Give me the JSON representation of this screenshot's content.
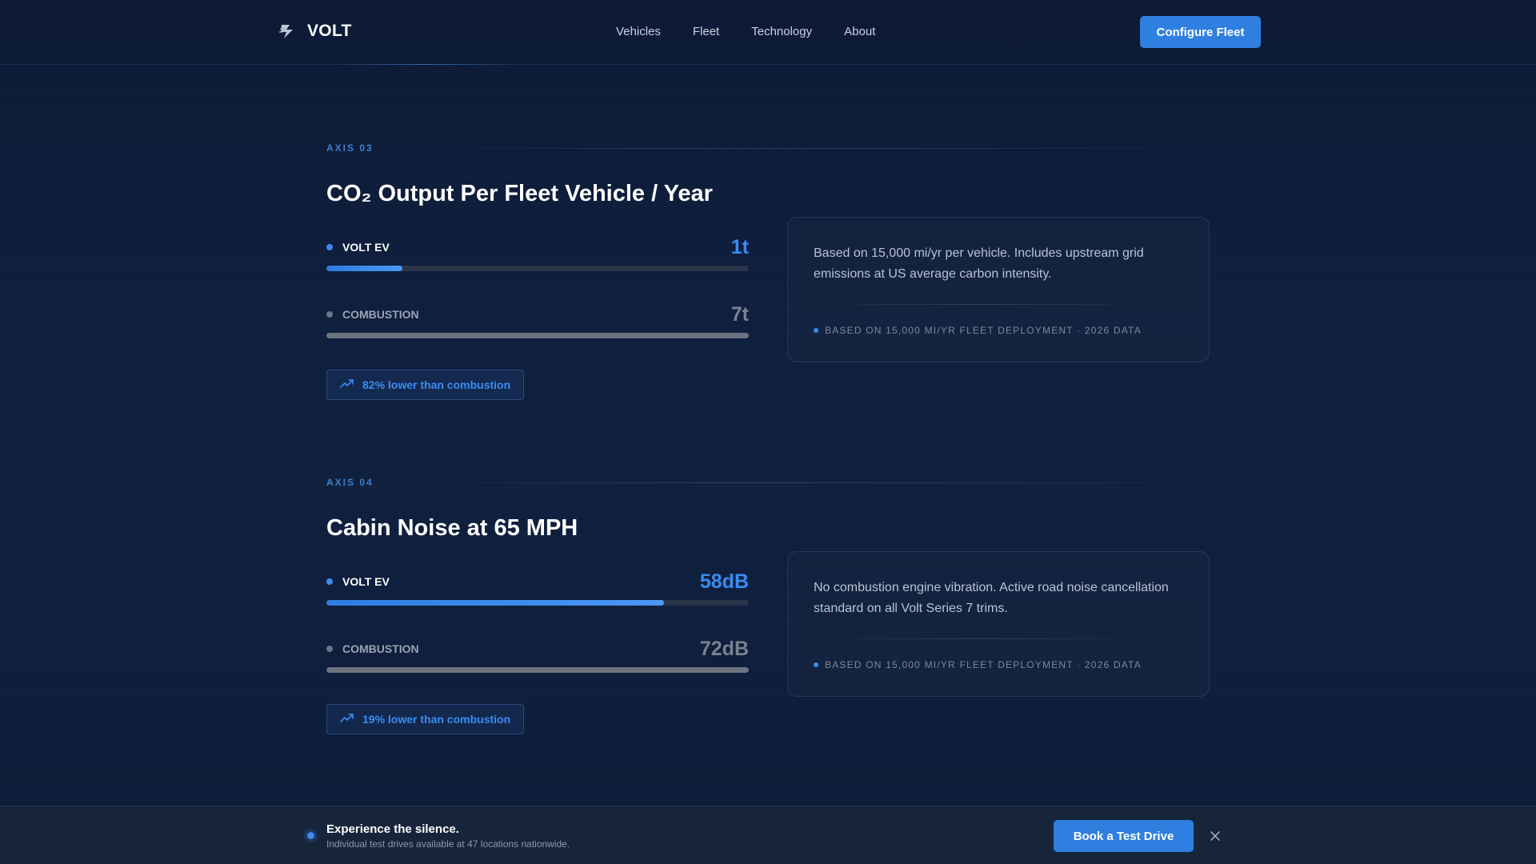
{
  "header": {
    "brand": "VOLT",
    "brand_icon": "lightning-icon",
    "nav": [
      "Vehicles",
      "Fleet",
      "Technology",
      "About"
    ],
    "cta": "Configure Fleet"
  },
  "colors": {
    "accent": "#2f7fe0",
    "ev": "#3a8cf2",
    "combustion": "#7a8290",
    "background": "#0e1d3b"
  },
  "sections": [
    {
      "axis": "AXIS 03",
      "title": "CO₂ Output Per Fleet Vehicle / Year",
      "ev": {
        "label": "VOLT EV",
        "value": "1t",
        "fraction": 0.18
      },
      "combustion": {
        "label": "COMBUSTION",
        "value": "7t",
        "fraction": 1.0
      },
      "badge": "82% lower than combustion",
      "card_text": "Based on 15,000 mi/yr per vehicle. Includes upstream grid emissions at US average carbon intensity.",
      "card_footer": "BASED ON 15,000 MI/YR FLEET DEPLOYMENT · 2026 DATA"
    },
    {
      "axis": "AXIS 04",
      "title": "Cabin Noise at 65 MPH",
      "ev": {
        "label": "VOLT EV",
        "value": "58dB",
        "fraction": 0.8
      },
      "combustion": {
        "label": "COMBUSTION",
        "value": "72dB",
        "fraction": 1.0
      },
      "badge": "19% lower than combustion",
      "card_text": "No combustion engine vibration. Active road noise cancellation standard on all Volt Series 7 trims.",
      "card_footer": "BASED ON 15,000 MI/YR FLEET DEPLOYMENT · 2026 DATA"
    }
  ],
  "bottom_bar": {
    "title": "Experience the silence.",
    "subtitle": "Individual test drives available at 47 locations nationwide.",
    "cta": "Book a Test Drive",
    "close_icon": "close-icon"
  }
}
